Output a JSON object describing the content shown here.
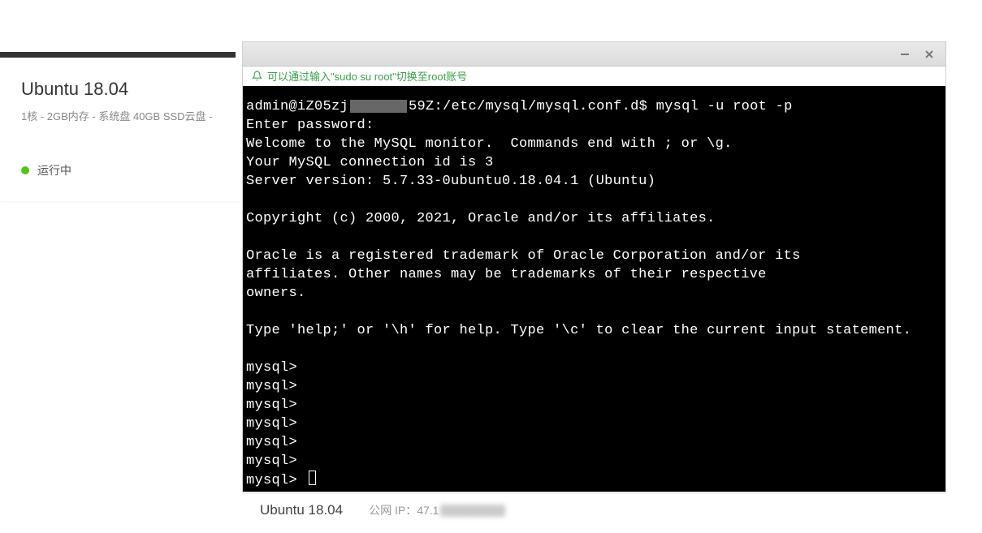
{
  "sidebar": {
    "instance_title": "Ubuntu 18.04",
    "instance_specs": "1核 - 2GB内存 - 系统盘 40GB SSD云盘 -",
    "status_text": "运行中",
    "status_color": "#52c41a"
  },
  "terminal": {
    "tip_text": "可以通过输入\"sudo su root\"切换至root账号",
    "lines": [
      {
        "type": "promptline",
        "prefix": "admin@iZ05zj",
        "redacted": true,
        "suffix": "59Z:/etc/mysql/mysql.conf.d$ mysql -u root -p"
      },
      {
        "type": "text",
        "text": "Enter password:"
      },
      {
        "type": "text",
        "text": "Welcome to the MySQL monitor.  Commands end with ; or \\g."
      },
      {
        "type": "text",
        "text": "Your MySQL connection id is 3"
      },
      {
        "type": "text",
        "text": "Server version: 5.7.33-0ubuntu0.18.04.1 (Ubuntu)"
      },
      {
        "type": "blank"
      },
      {
        "type": "text",
        "text": "Copyright (c) 2000, 2021, Oracle and/or its affiliates."
      },
      {
        "type": "blank"
      },
      {
        "type": "text",
        "text": "Oracle is a registered trademark of Oracle Corporation and/or its"
      },
      {
        "type": "text",
        "text": "affiliates. Other names may be trademarks of their respective"
      },
      {
        "type": "text",
        "text": "owners."
      },
      {
        "type": "blank"
      },
      {
        "type": "text",
        "text": "Type 'help;' or '\\h' for help. Type '\\c' to clear the current input statement."
      },
      {
        "type": "blank"
      },
      {
        "type": "text",
        "text": "mysql>"
      },
      {
        "type": "text",
        "text": "mysql>"
      },
      {
        "type": "text",
        "text": "mysql>"
      },
      {
        "type": "text",
        "text": "mysql>"
      },
      {
        "type": "text",
        "text": "mysql>"
      },
      {
        "type": "text",
        "text": "mysql>"
      },
      {
        "type": "cursorline",
        "text": "mysql>"
      }
    ]
  },
  "bottom": {
    "title": "Ubuntu 18.04",
    "ip_label": "公网 IP：",
    "ip_prefix": "47.1"
  }
}
